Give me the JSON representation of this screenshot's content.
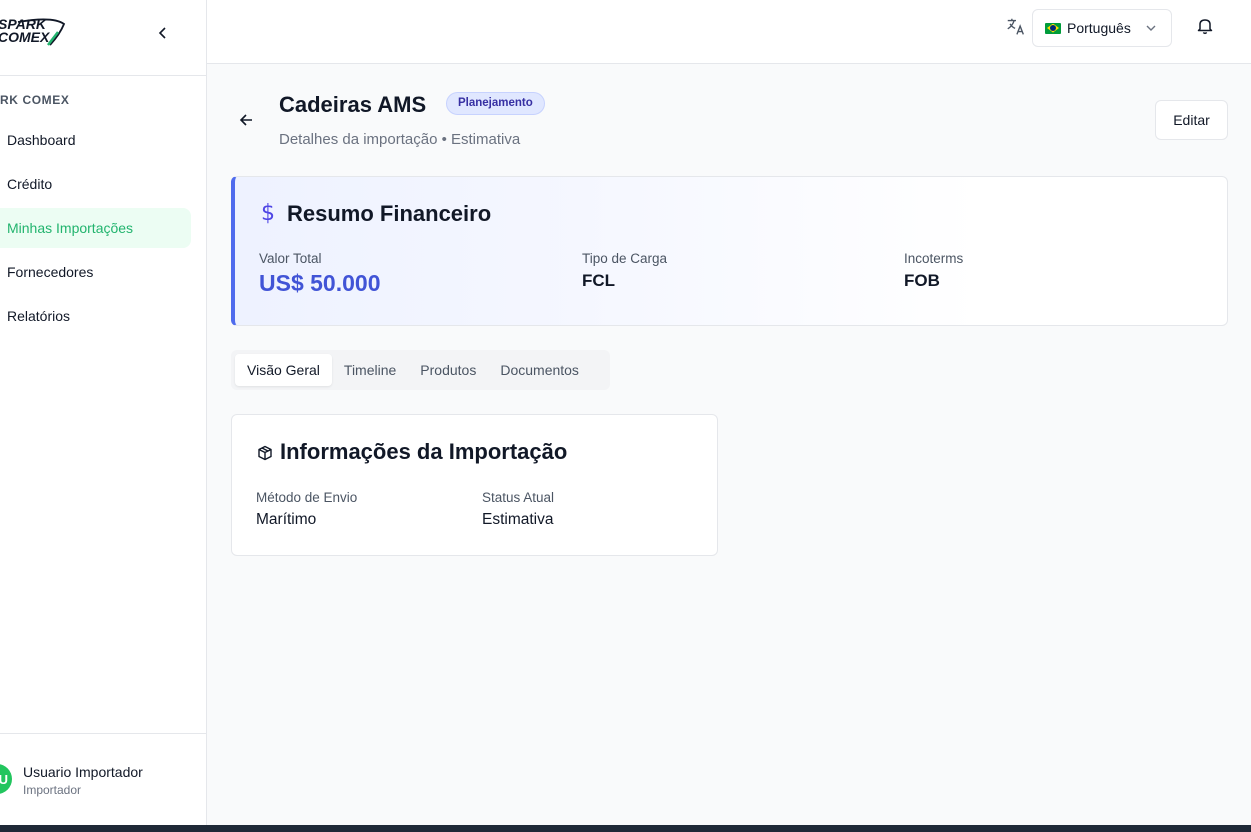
{
  "brand": {
    "logo_line1": "SPARK",
    "logo_line2": "COMEX",
    "accent": "#22b46e"
  },
  "sidebar": {
    "section_label": "RK COMEX",
    "items": [
      {
        "label": "Dashboard",
        "active": false
      },
      {
        "label": "Crédito",
        "active": false
      },
      {
        "label": "Minhas Importações",
        "active": true
      },
      {
        "label": "Fornecedores",
        "active": false
      },
      {
        "label": "Relatórios",
        "active": false
      }
    ],
    "user": {
      "initial": "U",
      "name": "Usuario Importador",
      "role": "Importador"
    }
  },
  "header": {
    "language": "Português"
  },
  "page": {
    "title": "Cadeiras AMS",
    "status_badge": "Planejamento",
    "subtitle": "Detalhes da importação • Estimativa",
    "edit_label": "Editar"
  },
  "financial": {
    "title": "Resumo Financeiro",
    "total_label": "Valor Total",
    "total_value": "US$ 50.000",
    "cargo_label": "Tipo de Carga",
    "cargo_value": "FCL",
    "incoterms_label": "Incoterms",
    "incoterms_value": "FOB"
  },
  "tabs": [
    {
      "label": "Visão Geral",
      "active": true
    },
    {
      "label": "Timeline",
      "active": false
    },
    {
      "label": "Produtos",
      "active": false
    },
    {
      "label": "Documentos",
      "active": false
    }
  ],
  "info": {
    "title": "Informações da Importação",
    "method_label": "Método de Envio",
    "method_value": "Marítimo",
    "status_label": "Status Atual",
    "status_value": "Estimativa"
  }
}
